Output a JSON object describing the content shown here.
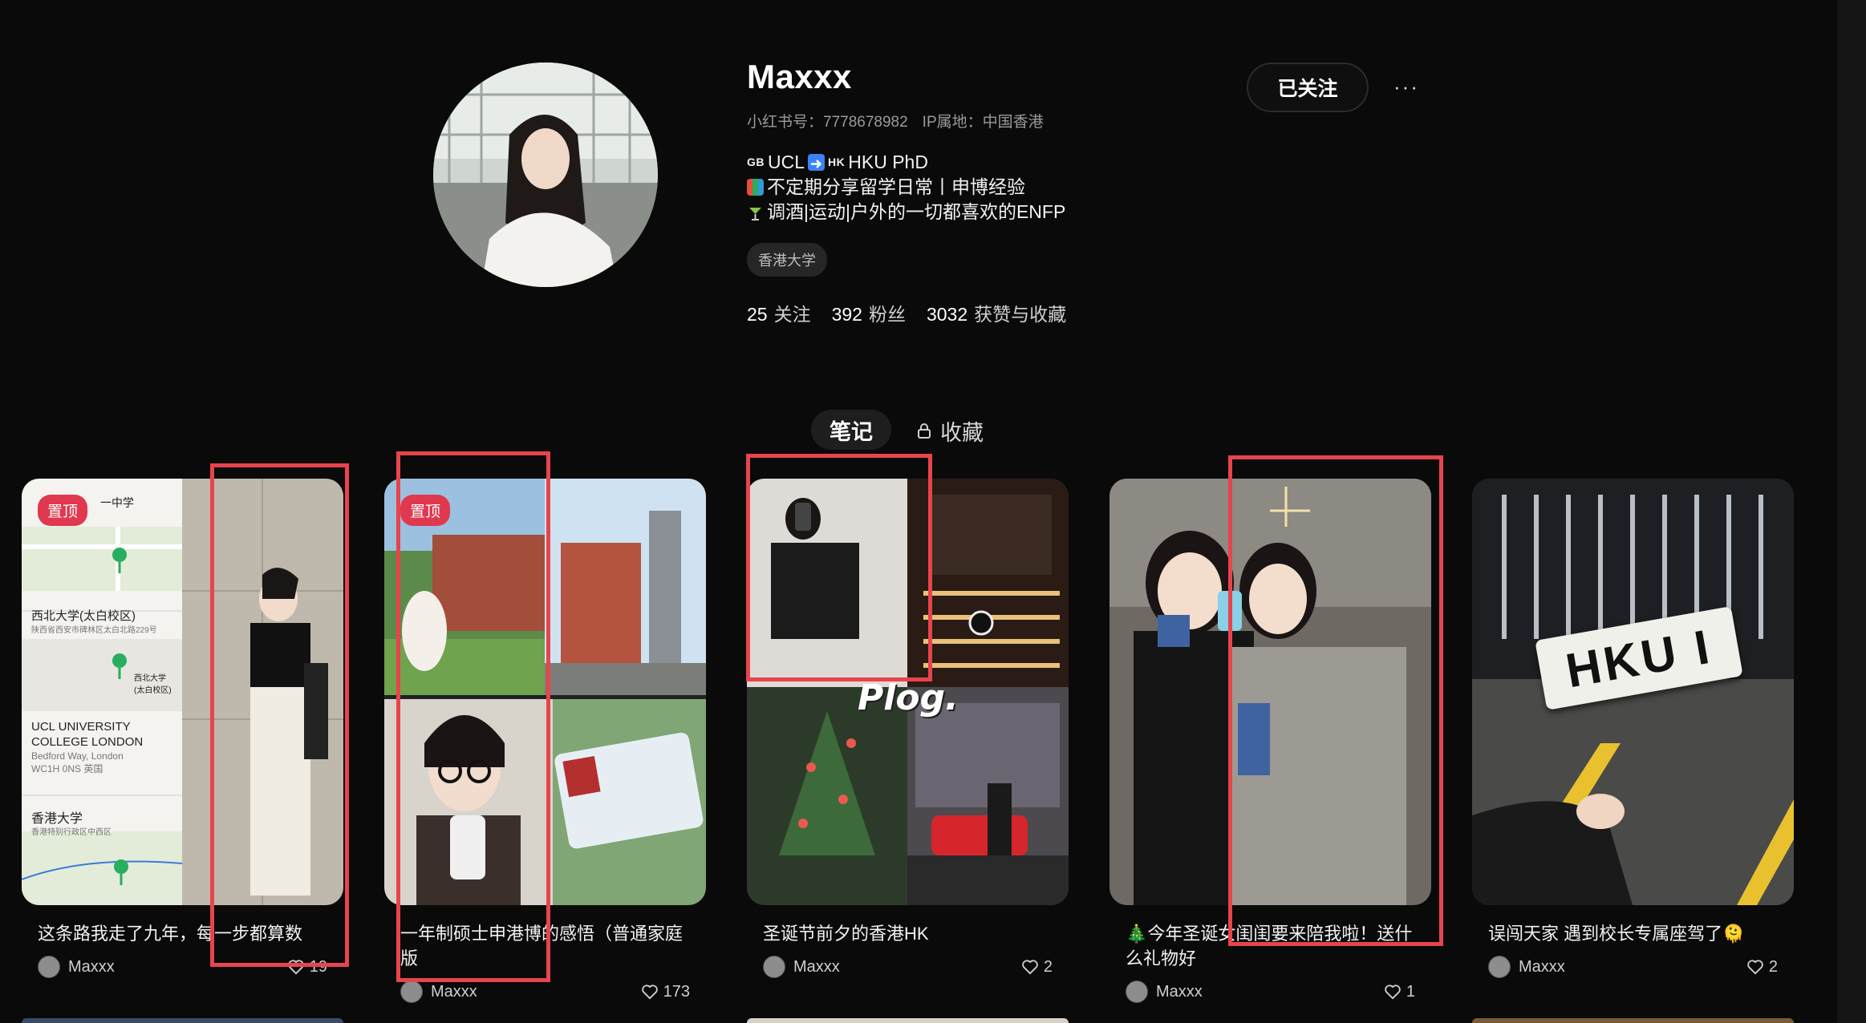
{
  "profile": {
    "username": "Maxxx",
    "red_id": "小红书号：7778678982",
    "ip_location": "IP属地：中国香港",
    "bio": {
      "line1_gb": "GB",
      "line1_ucl": "UCL",
      "line1_hk": "HK",
      "line1_rest": "HKU PhD",
      "line2": "不定期分享留学日常丨申博经验",
      "line3": "调酒|运动|户外的一切都喜欢的ENFP"
    },
    "tag": "香港大学",
    "stats": {
      "following_num": "25",
      "following_label": "关注",
      "followers_num": "392",
      "followers_label": "粉丝",
      "likes_num": "3032",
      "likes_label": "获赞与收藏"
    },
    "follow_button": "已关注",
    "more_button": "···"
  },
  "tabs": {
    "notes": "笔记",
    "collections": "收藏"
  },
  "cards": [
    {
      "badge": "置顶",
      "title": "这条路我走了九年，每一步都算数",
      "author": "Maxxx",
      "likes": "19",
      "map_labels": [
        "一中学",
        "西北大学(太白校区)",
        "陕西省西安市碑林区太白北路229号",
        "西北大学(太白校区)",
        "UCL UNIVERSITY COLLEGE LONDON",
        "Bedford Way, London WC1H 0NS 英国",
        "香港大学",
        "香港特别行政区中西区"
      ]
    },
    {
      "badge": "置顶",
      "title": "一年制硕士申港博的感悟（普通家庭版",
      "author": "Maxxx",
      "likes": "173"
    },
    {
      "title": "圣诞节前夕的香港HK",
      "author": "Maxxx",
      "likes": "2",
      "overlay_text": "Plog."
    },
    {
      "title": "🎄今年圣诞女闺闺要来陪我啦！送什么礼物好",
      "author": "Maxxx",
      "likes": "1"
    },
    {
      "title": "误闯天家 遇到校长专属座驾了🫠",
      "author": "Maxxx",
      "likes": "2",
      "overlay_text": "HKU I"
    }
  ],
  "colors": {
    "background": "#0a0a0a",
    "badge_red": "#e0384e",
    "highlight_red": "#e8444c"
  }
}
